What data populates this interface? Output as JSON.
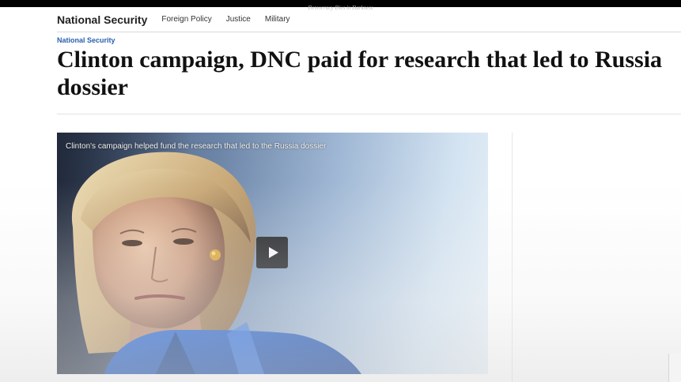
{
  "topbar": {
    "tagline": "Democracy Dies in Darkness"
  },
  "nav": {
    "section_title": "National Security",
    "links": [
      "Foreign Policy",
      "Justice",
      "Military"
    ]
  },
  "article": {
    "kicker": "National Security",
    "headline_line1": "Clinton campaign, DNC paid for research that led to Russia",
    "headline_line2": "dossier"
  },
  "video": {
    "caption": "Clinton's campaign helped fund the research that led to the Russia dossier",
    "play_icon": "play-icon"
  },
  "colors": {
    "kicker": "#2a5fae",
    "topbar": "#000000",
    "jacket": "#1f5fc8"
  }
}
